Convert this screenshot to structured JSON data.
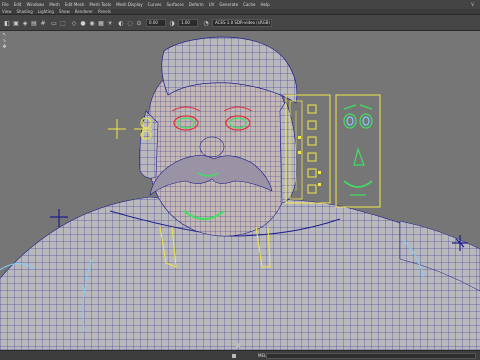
{
  "menubar": {
    "items": [
      "File",
      "Edit",
      "Windows",
      "Mesh",
      "Edit Mesh",
      "Mesh Tools",
      "Mesh Display",
      "Curves",
      "Surfaces",
      "Deform",
      "UV",
      "Generate",
      "Cache",
      "Help"
    ],
    "right_letter": "V"
  },
  "panel_menu": {
    "items": [
      "View",
      "Shading",
      "Lighting",
      "Show",
      "Renderer",
      "Panels"
    ]
  },
  "toolbar": {
    "field_a": "0.00",
    "field_b": "1.00",
    "camera_info": "ACES 1.0 SDR-video (sRGB)"
  },
  "statusbar": {
    "mel_label": "MEL"
  },
  "colors": {
    "viewport_bg": "#767676",
    "wire": "#1d1d8c",
    "rig_yellow": "#f0e64a",
    "rig_green": "#3ee060",
    "rig_red": "#e03040",
    "rig_cyan": "#7fd0ff"
  }
}
